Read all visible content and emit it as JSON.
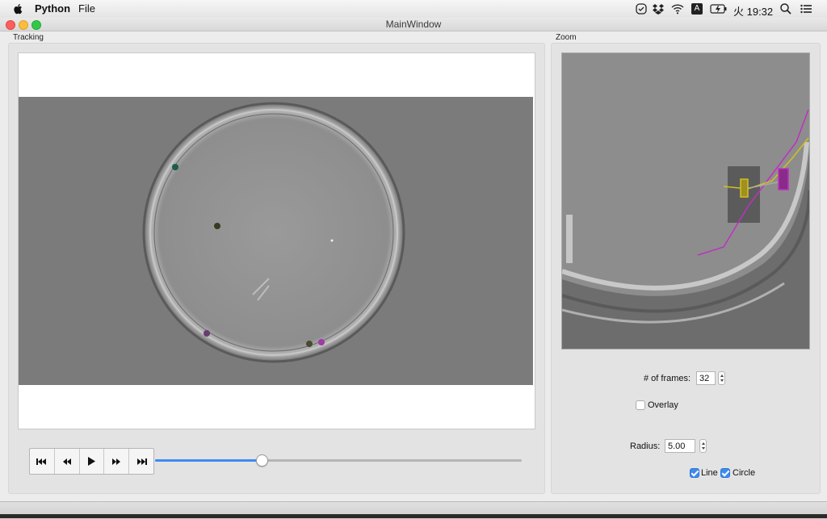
{
  "menubar": {
    "app_name": "Python",
    "menu_file": "File",
    "clock": "火 19:32",
    "input_badge": "A"
  },
  "window": {
    "title": "MainWindow"
  },
  "tracking": {
    "group_label": "Tracking"
  },
  "zoom": {
    "group_label": "Zoom",
    "frames_label": "# of frames:",
    "frames_value": "32",
    "overlay_label": "Overlay",
    "overlay_checked": false,
    "radius_label": "Radius:",
    "radius_value": "5.00",
    "line_label": "Line",
    "line_checked": true,
    "circle_label": "Circle",
    "circle_checked": true
  },
  "player": {
    "progress": 0.29,
    "buttons": [
      "skip-to-start-icon",
      "rewind-icon",
      "play-icon",
      "fast-forward-icon",
      "skip-to-end-icon"
    ]
  },
  "colors": {
    "accent": "#3d8bf0",
    "track_magenta": "#c030c0",
    "track_yellow": "#d4c020"
  }
}
